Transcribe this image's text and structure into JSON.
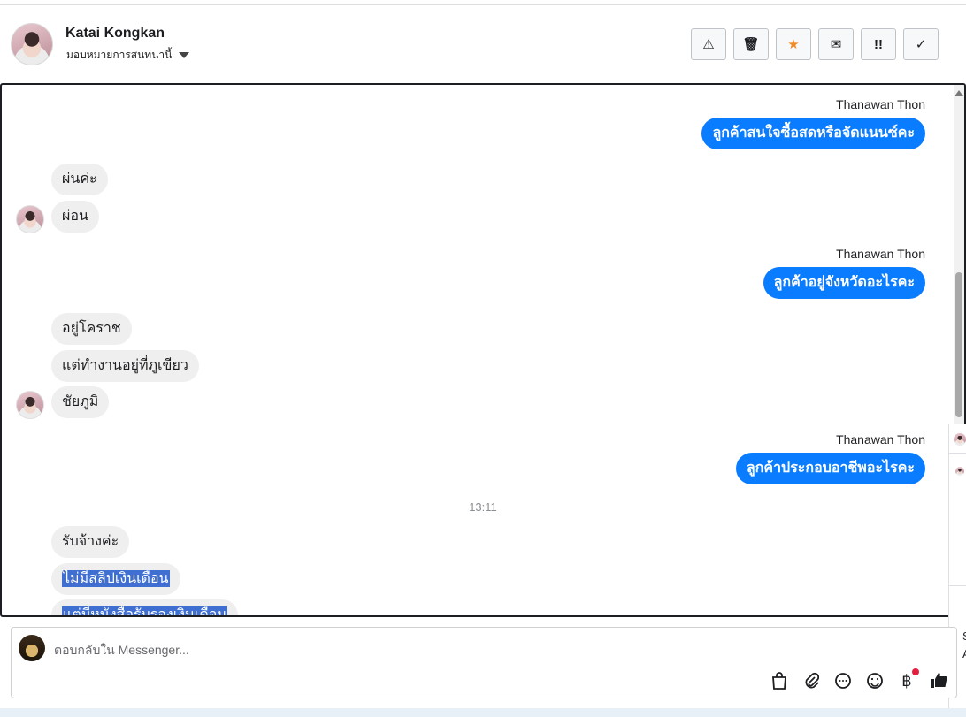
{
  "header": {
    "contact_name": "Katai Kongkan",
    "assign_label": "มอบหมายการสนทนานี้",
    "actions": [
      {
        "name": "report-button",
        "icon": "⚠"
      },
      {
        "name": "delete-button",
        "icon": "🗑"
      },
      {
        "name": "star-button",
        "icon": "★"
      },
      {
        "name": "mark-unread-button",
        "icon": "✉"
      },
      {
        "name": "spam-button",
        "icon": "!!"
      },
      {
        "name": "done-button",
        "icon": "✓"
      }
    ]
  },
  "thread": {
    "messages": [
      {
        "sender": "Thanawan Thon",
        "text": "ลูกค้าสนใจซื้อสดหรือจัดแนนซ์คะ"
      },
      {
        "text": "ผ่นค่ะ"
      },
      {
        "text": "ผ่อน"
      },
      {
        "sender": "Thanawan Thon",
        "text": "ลูกค้าอยู่จังหวัดอะไรคะ"
      },
      {
        "text": "อยู่โคราช"
      },
      {
        "text": "แต่ทำงานอยู่ที่ภูเขียว"
      },
      {
        "text": "ชัยภูมิ"
      },
      {
        "sender": "Thanawan Thon",
        "text": "ลูกค้าประกอบอาชีพอะไรคะ"
      },
      {
        "time": "13:11"
      },
      {
        "text": "รับจ้างค่ะ"
      },
      {
        "text": "ไม่มีสลิปเงินเดือน"
      },
      {
        "text": "แต่มีหนังสือรับรองเงินเดือน"
      }
    ]
  },
  "side_panel": {
    "letter_s": "S",
    "letter_a": "A"
  },
  "composer": {
    "placeholder": "ตอบกลับใน Messenger...",
    "tools": [
      "shopping-bag-icon",
      "paperclip-icon",
      "chat-bubble-icon",
      "emoji-icon",
      "baht-icon",
      "thumbs-up-icon"
    ]
  },
  "colors": {
    "outgoing_bubble": "#0a7cff",
    "incoming_bubble": "#efefef",
    "selection": "#3f6fd1",
    "star": "#f08a24"
  }
}
